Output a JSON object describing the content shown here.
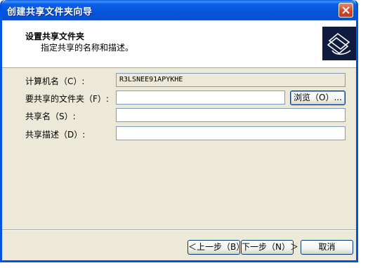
{
  "window": {
    "title": "创建共享文件夹向导"
  },
  "header": {
    "title": "设置共享文件夹",
    "subtitle": "指定共享的名称和描述。",
    "icon": "shared-folder-wizard-icon"
  },
  "form": {
    "computer_name": {
      "label": "计算机名（C）:",
      "value": "R3LSNEE91APYKHE"
    },
    "folder_to_share": {
      "label": "要共享的文件夹（F）:",
      "value": "",
      "browse_label": "浏览（O）..."
    },
    "share_name": {
      "label": "共享名（S）:",
      "value": ""
    },
    "share_description": {
      "label": "共享描述（D）:",
      "value": ""
    }
  },
  "footer": {
    "back_label": "＜上一步（B）",
    "next_label": "下一步（N）＞",
    "cancel_label": "取消"
  },
  "colors": {
    "titlebar": "#0a5fe8",
    "dialog_bg": "#ece9d8",
    "close_button": "#d4452a"
  }
}
